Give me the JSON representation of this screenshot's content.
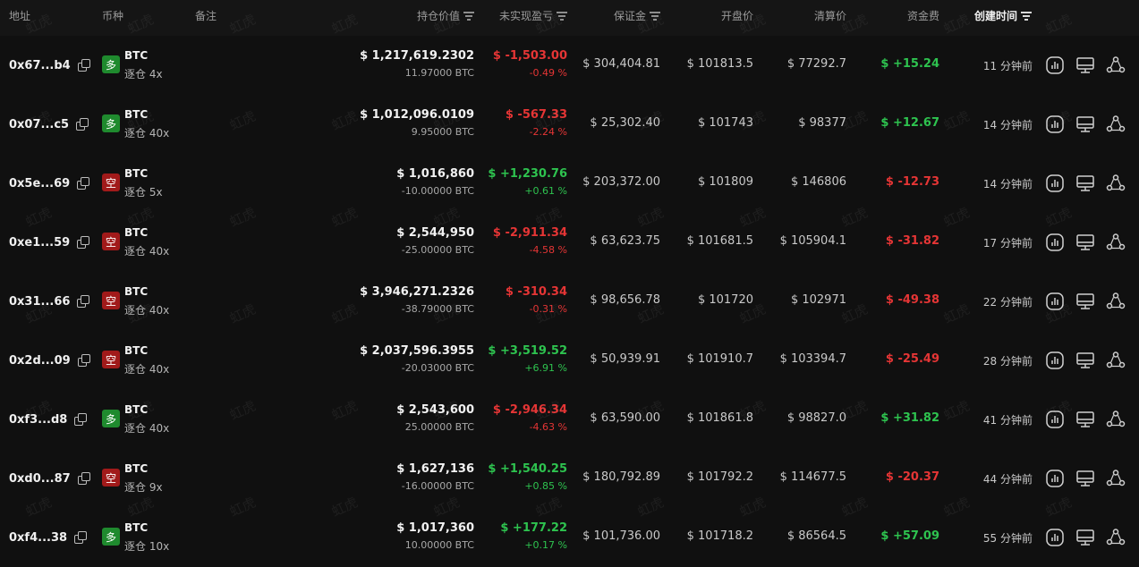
{
  "header": {
    "address": "地址",
    "coin": "币种",
    "note": "备注",
    "position_value": "持仓价值",
    "unrealized_pnl": "未实现盈亏",
    "margin": "保证金",
    "open_price": "开盘价",
    "liq_price": "清算价",
    "funding_fee": "资金费",
    "created_time": "创建时间"
  },
  "watermark": "虹虎",
  "colors": {
    "long": "#1f8a2e",
    "short": "#a11a1a",
    "positive": "#2ec34f",
    "negative": "#e53535"
  },
  "rows": [
    {
      "address": "0x67...b4",
      "side": "long",
      "side_label": "多",
      "coin": "BTC",
      "leverage": "逐仓 4x",
      "value": "$ 1,217,619.2302",
      "size": "11.97000 BTC",
      "pnl": "$ -1,503.00",
      "pnl_pct": "-0.49 %",
      "pnl_sign": "neg",
      "margin": "$ 304,404.81",
      "open": "$ 101813.5",
      "liq": "$ 77292.7",
      "fee": "$ +15.24",
      "fee_sign": "pos",
      "time": "11 分钟前"
    },
    {
      "address": "0x07...c5",
      "side": "long",
      "side_label": "多",
      "coin": "BTC",
      "leverage": "逐仓 40x",
      "value": "$ 1,012,096.0109",
      "size": "9.95000 BTC",
      "pnl": "$ -567.33",
      "pnl_pct": "-2.24 %",
      "pnl_sign": "neg",
      "margin": "$ 25,302.40",
      "open": "$ 101743",
      "liq": "$ 98377",
      "fee": "$ +12.67",
      "fee_sign": "pos",
      "time": "14 分钟前"
    },
    {
      "address": "0x5e...69",
      "side": "short",
      "side_label": "空",
      "coin": "BTC",
      "leverage": "逐仓 5x",
      "value": "$ 1,016,860",
      "size": "-10.00000 BTC",
      "pnl": "$ +1,230.76",
      "pnl_pct": "+0.61 %",
      "pnl_sign": "pos",
      "margin": "$ 203,372.00",
      "open": "$ 101809",
      "liq": "$ 146806",
      "fee": "$ -12.73",
      "fee_sign": "neg",
      "time": "14 分钟前"
    },
    {
      "address": "0xe1...59",
      "side": "short",
      "side_label": "空",
      "coin": "BTC",
      "leverage": "逐仓 40x",
      "value": "$ 2,544,950",
      "size": "-25.00000 BTC",
      "pnl": "$ -2,911.34",
      "pnl_pct": "-4.58 %",
      "pnl_sign": "neg",
      "margin": "$ 63,623.75",
      "open": "$ 101681.5",
      "liq": "$ 105904.1",
      "fee": "$ -31.82",
      "fee_sign": "neg",
      "time": "17 分钟前"
    },
    {
      "address": "0x31...66",
      "side": "short",
      "side_label": "空",
      "coin": "BTC",
      "leverage": "逐仓 40x",
      "value": "$ 3,946,271.2326",
      "size": "-38.79000 BTC",
      "pnl": "$ -310.34",
      "pnl_pct": "-0.31 %",
      "pnl_sign": "neg",
      "margin": "$ 98,656.78",
      "open": "$ 101720",
      "liq": "$ 102971",
      "fee": "$ -49.38",
      "fee_sign": "neg",
      "time": "22 分钟前"
    },
    {
      "address": "0x2d...09",
      "side": "short",
      "side_label": "空",
      "coin": "BTC",
      "leverage": "逐仓 40x",
      "value": "$ 2,037,596.3955",
      "size": "-20.03000 BTC",
      "pnl": "$ +3,519.52",
      "pnl_pct": "+6.91 %",
      "pnl_sign": "pos",
      "margin": "$ 50,939.91",
      "open": "$ 101910.7",
      "liq": "$ 103394.7",
      "fee": "$ -25.49",
      "fee_sign": "neg",
      "time": "28 分钟前"
    },
    {
      "address": "0xf3...d8",
      "side": "long",
      "side_label": "多",
      "coin": "BTC",
      "leverage": "逐仓 40x",
      "value": "$ 2,543,600",
      "size": "25.00000 BTC",
      "pnl": "$ -2,946.34",
      "pnl_pct": "-4.63 %",
      "pnl_sign": "neg",
      "margin": "$ 63,590.00",
      "open": "$ 101861.8",
      "liq": "$ 98827.0",
      "fee": "$ +31.82",
      "fee_sign": "pos",
      "time": "41 分钟前"
    },
    {
      "address": "0xd0...87",
      "side": "short",
      "side_label": "空",
      "coin": "BTC",
      "leverage": "逐仓 9x",
      "value": "$ 1,627,136",
      "size": "-16.00000 BTC",
      "pnl": "$ +1,540.25",
      "pnl_pct": "+0.85 %",
      "pnl_sign": "pos",
      "margin": "$ 180,792.89",
      "open": "$ 101792.2",
      "liq": "$ 114677.5",
      "fee": "$ -20.37",
      "fee_sign": "neg",
      "time": "44 分钟前"
    },
    {
      "address": "0xf4...38",
      "side": "long",
      "side_label": "多",
      "coin": "BTC",
      "leverage": "逐仓 10x",
      "value": "$ 1,017,360",
      "size": "10.00000 BTC",
      "pnl": "$ +177.22",
      "pnl_pct": "+0.17 %",
      "pnl_sign": "pos",
      "margin": "$ 101,736.00",
      "open": "$ 101718.2",
      "liq": "$ 86564.5",
      "fee": "$ +57.09",
      "fee_sign": "pos",
      "time": "55 分钟前"
    }
  ]
}
